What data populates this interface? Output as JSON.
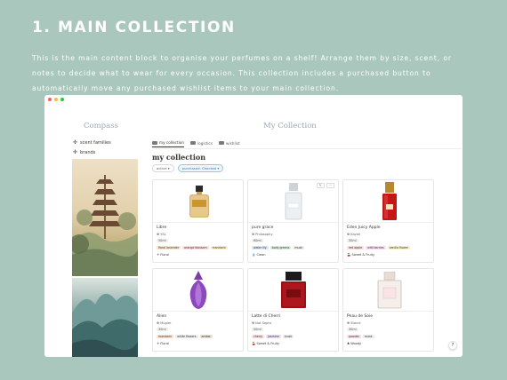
{
  "heading": "1. MAIN COLLECTION",
  "description": "This is the main content block to organise your perfumes on a shelf! Arrange them by size, scent, or notes to decide what to wear for every occasion. This collection includes a purchased button to automatically move any purchased wishlist items to your main collection.",
  "window": {
    "compass_title": "Compass",
    "collection_title": "My Collection",
    "sidebar": [
      {
        "icon": "compass-icon",
        "label": "scent families"
      },
      {
        "icon": "compass-icon",
        "label": "brands"
      }
    ],
    "tabs": [
      {
        "label": "my collection",
        "active": true
      },
      {
        "label": "logistics",
        "active": false
      },
      {
        "label": "wishlist",
        "active": false
      }
    ],
    "view_title": "my collection",
    "filters": {
      "active": "active",
      "purchased": "purchased: Checked"
    },
    "card_actions": [
      "✎",
      "···"
    ],
    "help_label": "?",
    "cards": [
      {
        "name": "Libre",
        "brand": "YSL",
        "size": "50ml",
        "tags": [
          {
            "text": "floral lavender",
            "color": "orange"
          },
          {
            "text": "orange blossom",
            "color": "red"
          },
          {
            "text": "mandarin",
            "color": "yellow"
          }
        ],
        "family": "Floral",
        "family_icon": "flower-icon"
      },
      {
        "name": "pure grace",
        "brand": "Philosophy",
        "size": "60ml",
        "tags": [
          {
            "text": "water lily",
            "color": "blue"
          },
          {
            "text": "body greens",
            "color": "green"
          },
          {
            "text": "musk",
            "color": "gray"
          }
        ],
        "family": "Clean",
        "family_icon": "drop-icon"
      },
      {
        "name": "Eden Juicy Apple",
        "brand": "Kayali",
        "size": "50ml",
        "tags": [
          {
            "text": "red apple",
            "color": "red"
          },
          {
            "text": "wild berries",
            "color": "pink"
          },
          {
            "text": "vanilla flower",
            "color": "yellow"
          }
        ],
        "family": "Sweet & Fruity",
        "family_icon": "cherry-icon"
      },
      {
        "name": "Alien",
        "brand": "Mugler",
        "size": "30ml",
        "tags": [
          {
            "text": "mandarin",
            "color": "orange"
          },
          {
            "text": "white flowers",
            "color": "gray"
          },
          {
            "text": "amber",
            "color": "brown"
          }
        ],
        "family": "Floral",
        "family_icon": "flower-icon"
      },
      {
        "name": "Latte di Cherri",
        "brand": "Not Sopro",
        "size": "50ml",
        "tags": [
          {
            "text": "cherry",
            "color": "red"
          },
          {
            "text": "jasmine",
            "color": "purple"
          },
          {
            "text": "musk",
            "color": "gray"
          }
        ],
        "family": "Sweet & Fruity",
        "family_icon": "cherry-icon"
      },
      {
        "name": "Peau de Soie",
        "brand": "Starck",
        "size": "30ml",
        "tags": [
          {
            "text": "powder",
            "color": "pink"
          },
          {
            "text": "musk",
            "color": "gray"
          }
        ],
        "family": "Woody",
        "family_icon": "tree-icon"
      }
    ]
  }
}
